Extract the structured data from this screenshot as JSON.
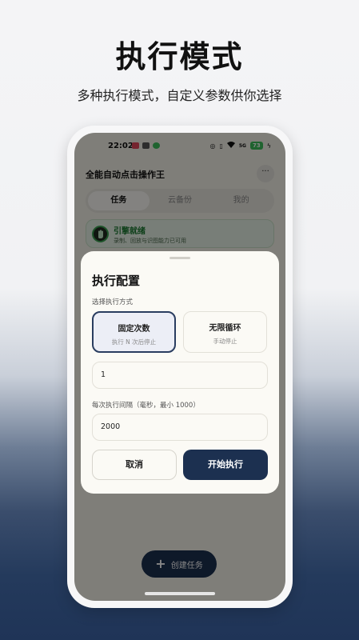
{
  "promo": {
    "headline": "执行模式",
    "subline": "多种执行模式，自定义参数供你选择"
  },
  "status_bar": {
    "time": "22:02",
    "battery": "73",
    "signal_text": "5G"
  },
  "app": {
    "title": "全能自动点击操作王",
    "more_label": "···",
    "tabs": [
      {
        "label": "任务",
        "active": true
      },
      {
        "label": "云备份",
        "active": false
      },
      {
        "label": "我的",
        "active": false
      }
    ],
    "engine_card": {
      "title": "引擎就绪",
      "subtitle": "录制、回放与识图能力已可用"
    },
    "fab": {
      "plus": "+",
      "label": "创建任务"
    }
  },
  "dialog": {
    "title": "执行配置",
    "mode_label": "选择执行方式",
    "modes": [
      {
        "name": "固定次数",
        "desc": "执行 N 次后停止",
        "selected": true
      },
      {
        "name": "无限循环",
        "desc": "手动停止",
        "selected": false
      }
    ],
    "count_value": "1",
    "interval_label": "每次执行间隔（毫秒，最小 1000）",
    "interval_value": "2000",
    "cancel_label": "取消",
    "start_label": "开始执行"
  },
  "colors": {
    "primary": "#1c3050",
    "engine_green": "#1b7a32",
    "battery_green": "#3cbf5b"
  }
}
